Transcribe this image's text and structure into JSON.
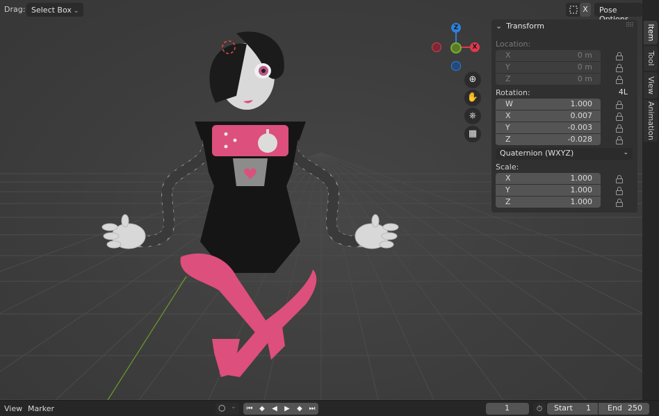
{
  "header": {
    "drag_label": "Drag:",
    "drag_mode": "Select Box",
    "xray_label": "X",
    "pose_options": "Pose Options"
  },
  "gizmo": {
    "z": "Z",
    "x": "X"
  },
  "transform_panel": {
    "title": "Transform",
    "location": {
      "label": "Location:",
      "rows": [
        {
          "axis": "X",
          "value": "0 m"
        },
        {
          "axis": "Y",
          "value": "0 m"
        },
        {
          "axis": "Z",
          "value": "0 m"
        }
      ]
    },
    "rotation": {
      "label": "Rotation:",
      "lock_mode": "4L",
      "rows": [
        {
          "axis": "W",
          "value": "1.000"
        },
        {
          "axis": "X",
          "value": "0.007"
        },
        {
          "axis": "Y",
          "value": "-0.003"
        },
        {
          "axis": "Z",
          "value": "-0.028"
        }
      ],
      "mode": "Quaternion (WXYZ)"
    },
    "scale": {
      "label": "Scale:",
      "rows": [
        {
          "axis": "X",
          "value": "1.000"
        },
        {
          "axis": "Y",
          "value": "1.000"
        },
        {
          "axis": "Z",
          "value": "1.000"
        }
      ]
    }
  },
  "sidebar_tabs": [
    "Item",
    "Tool",
    "View",
    "Animation"
  ],
  "timeline": {
    "menu_view": "View",
    "menu_marker": "Marker",
    "current_frame": "1",
    "start_label": "Start",
    "start_value": "1",
    "end_label": "End",
    "end_value": "250"
  },
  "colors": {
    "axis_x": "#e0394c",
    "axis_y": "#7ab12c",
    "axis_z": "#2e7fdc",
    "character_pink": "#dd4f7c",
    "character_black": "#151515"
  },
  "icons": [
    "pivot-icon",
    "zoom-icon",
    "hand-icon",
    "camera-icon",
    "grid-icon",
    "lock-icon",
    "stopwatch-icon",
    "record-icon"
  ]
}
